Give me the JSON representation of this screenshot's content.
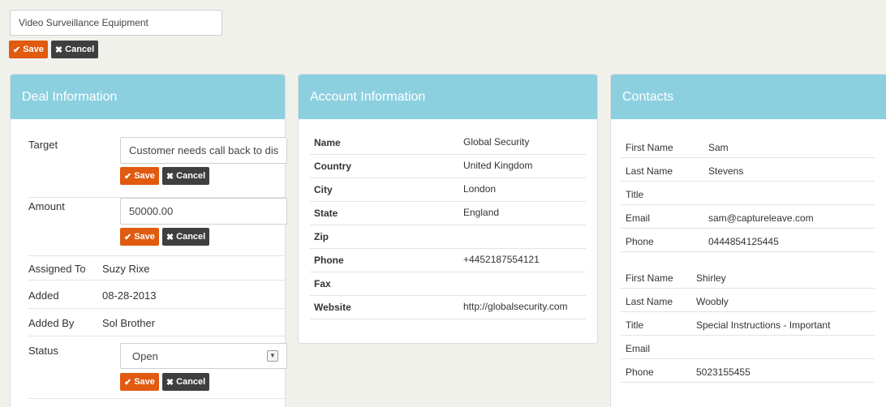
{
  "deal_title_input": {
    "value": "Video Surveillance Equipment"
  },
  "buttons": {
    "save": "Save",
    "cancel": "Cancel"
  },
  "deal_panel": {
    "title": "Deal Information",
    "target": {
      "label": "Target",
      "value": "Customer needs call back to dis"
    },
    "amount": {
      "label": "Amount",
      "value": "50000.00"
    },
    "assigned_to": {
      "label": "Assigned To",
      "value": "Suzy Rixe"
    },
    "added": {
      "label": "Added",
      "value": "08-28-2013"
    },
    "added_by": {
      "label": "Added By",
      "value": "Sol Brother"
    },
    "status": {
      "label": "Status",
      "value": "Open"
    }
  },
  "account_panel": {
    "title": "Account Information",
    "rows": [
      {
        "label": "Name",
        "value": "Global Security"
      },
      {
        "label": "Country",
        "value": "United Kingdom"
      },
      {
        "label": "City",
        "value": "London"
      },
      {
        "label": "State",
        "value": "England"
      },
      {
        "label": "Zip",
        "value": ""
      },
      {
        "label": "Phone",
        "value": "+4452187554121"
      },
      {
        "label": "Fax",
        "value": ""
      },
      {
        "label": "Website",
        "value": "http://globalsecurity.com"
      }
    ]
  },
  "contacts_panel": {
    "title": "Contacts",
    "contacts": [
      {
        "rows": [
          {
            "label": "First Name",
            "value": "Sam"
          },
          {
            "label": "Last Name",
            "value": "Stevens"
          },
          {
            "label": "Title",
            "value": ""
          },
          {
            "label": "Email",
            "value": "sam@captureleave.com"
          },
          {
            "label": "Phone",
            "value": "0444854125445"
          }
        ]
      },
      {
        "rows": [
          {
            "label": "First Name",
            "value": "Shirley"
          },
          {
            "label": "Last Name",
            "value": "Woobly"
          },
          {
            "label": "Title",
            "value": "Special Instructions - Important"
          },
          {
            "label": "Email",
            "value": ""
          },
          {
            "label": "Phone",
            "value": "5023155455"
          }
        ]
      }
    ]
  },
  "colors": {
    "panel_header": "#8cd0e0",
    "save": "#e05a0f",
    "cancel": "#3f3f3f",
    "background": "#f1f1ec"
  },
  "icons": {
    "save": "check-icon",
    "cancel": "x-icon",
    "select": "chevron-down-icon"
  }
}
